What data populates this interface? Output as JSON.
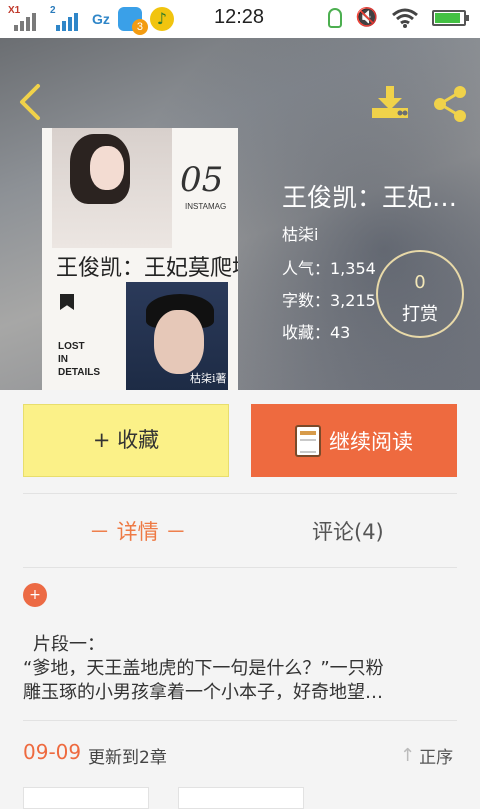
{
  "statusbar": {
    "sim1_tag": "X1",
    "sim2_tag": "2",
    "network": "Gz",
    "badge_count": "3",
    "time": "12:28",
    "battery_level": 0.9,
    "icons": [
      "signal-icon",
      "signal-icon",
      "app-icon",
      "music-icon",
      "bulb-icon",
      "mute-icon",
      "wifi-icon",
      "battery-icon"
    ]
  },
  "book": {
    "title": "王俊凯：王妃…",
    "author": "枯柒i",
    "popularity": "人气：1,354",
    "word_count": "字数：3,215",
    "favorites": "收藏：43",
    "tip_count": "0",
    "tip_label": "打赏"
  },
  "cover": {
    "number": "05",
    "brand": "INSTAMAG",
    "title_text": "王俊凯：王妃莫爬墙",
    "lost_lines": [
      "LOST",
      "IN",
      "DETAILS"
    ],
    "signature": "枯柒i著"
  },
  "actions": {
    "collect_label": "+ 收藏",
    "read_label": "继续阅读"
  },
  "tabs": {
    "details": "－ 详情 －",
    "comments": "评论(4)"
  },
  "synopsis": {
    "line1": "片段一：",
    "line2": "“爹地，天王盖地虎的下一句是什么？”一只粉",
    "line3": "雕玉琢的小男孩拿着一个小本子，好奇地望…"
  },
  "update": {
    "date": "09-09",
    "text": "更新到2章",
    "sort_label": "正序"
  },
  "colors": {
    "accent": "#ee6a3f",
    "collect_bg": "#fbf188"
  }
}
